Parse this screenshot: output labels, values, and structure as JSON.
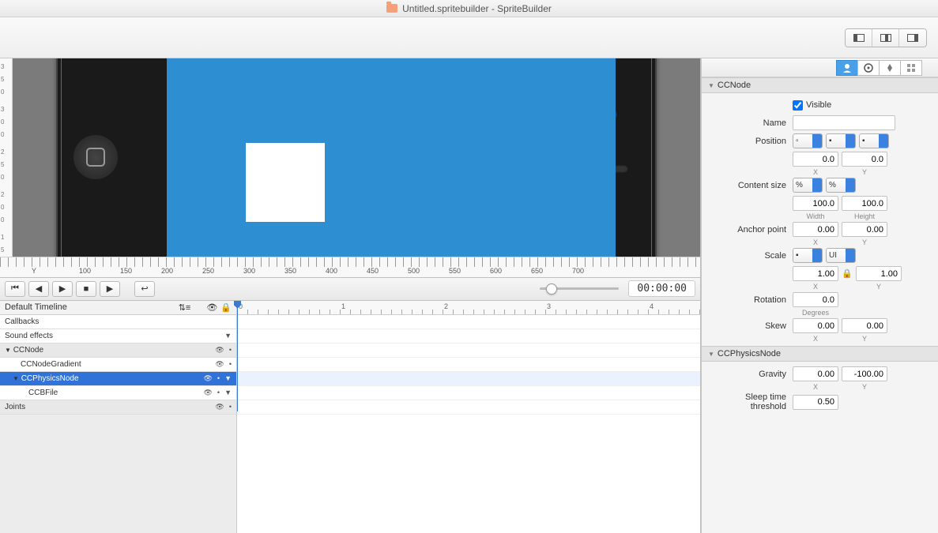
{
  "title": {
    "prefix": "Untitled.spritebuilder",
    "app": "SpriteBuilder"
  },
  "ruler_h": {
    "y_label": "Y",
    "ticks": [
      "100",
      "150",
      "200",
      "250",
      "300",
      "350",
      "400",
      "450",
      "500",
      "550",
      "600",
      "650",
      "700"
    ]
  },
  "playback": {
    "timecode": "00:00:00"
  },
  "timeline": {
    "dropdown": "Default Timeline",
    "ruler": [
      "0",
      "1",
      "2",
      "3",
      "4"
    ],
    "rows": [
      {
        "label": "Callbacks",
        "indent": 0,
        "kind": "plain"
      },
      {
        "label": "Sound effects",
        "indent": 0,
        "kind": "plain",
        "arrow": true
      },
      {
        "label": "CCNode",
        "indent": 0,
        "kind": "head",
        "tri": "▼",
        "eye": true,
        "dot": true
      },
      {
        "label": "CCNodeGradient",
        "indent": 2,
        "kind": "plain",
        "eye": true,
        "dot": true
      },
      {
        "label": "CCPhysicsNode",
        "indent": 1,
        "kind": "sel",
        "tri": "▼",
        "eye": true,
        "dot": true,
        "arrow": true
      },
      {
        "label": "CCBFile",
        "indent": 3,
        "kind": "plain",
        "eye": true,
        "dot": true,
        "arrow": true
      },
      {
        "label": "Joints",
        "indent": 0,
        "kind": "head",
        "eye": true,
        "dot": true
      }
    ]
  },
  "inspector": {
    "section1": "CCNode",
    "visible_label": "Visible",
    "visible": true,
    "name_label": "Name",
    "name": "",
    "position_label": "Position",
    "position": {
      "x": "0.0",
      "y": "0.0",
      "xl": "X",
      "yl": "Y"
    },
    "content_label": "Content size",
    "content": {
      "w": "100.0",
      "h": "100.0",
      "wl": "Width",
      "hl": "Height",
      "pct": "%"
    },
    "anchor_label": "Anchor point",
    "anchor": {
      "x": "0.00",
      "y": "0.00",
      "xl": "X",
      "yl": "Y"
    },
    "scale_label": "Scale",
    "scale": {
      "x": "1.00",
      "y": "1.00",
      "ui": "UI",
      "xl": "X",
      "yl": "Y"
    },
    "rotation_label": "Rotation",
    "rotation": {
      "v": "0.0",
      "l": "Degrees"
    },
    "skew_label": "Skew",
    "skew": {
      "x": "0.00",
      "y": "0.00",
      "xl": "X",
      "yl": "Y"
    },
    "section2": "CCPhysicsNode",
    "gravity_label": "Gravity",
    "gravity": {
      "x": "0.00",
      "y": "-100.00",
      "xl": "X",
      "yl": "Y"
    },
    "sleep_label": "Sleep time threshold",
    "sleep": "0.50"
  }
}
